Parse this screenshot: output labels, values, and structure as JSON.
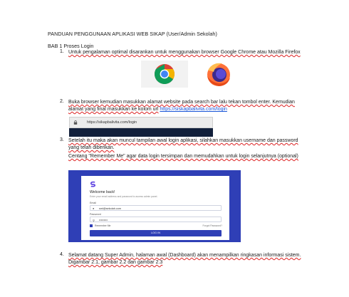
{
  "header": {
    "title": "PANDUAN PENGGUNAAN APLIKASI WEB SIKAP (User/Admin Sekolah)",
    "bab": "BAB 1 Proses Login"
  },
  "steps": [
    {
      "num": "1.",
      "text": "Untuk pengalaman optimal disarankan untuk menggunakan browser Google Chrome atau Mozilla Firefox"
    },
    {
      "num": "2.",
      "text": "Buka browser kemudian masukkan alamat website pada search bar lalu tekan tombol enter. Kemudian alamat yang final masukkan ke kolom url",
      "link": "https://siskapbalivita.com/login"
    },
    {
      "num": "3.",
      "text": "Setelah itu maka akan muncul tampilan awal login aplikasi, silahkan masukkan username dan password yang telah diberikan.",
      "extra": "Centang \"Remember Me\" agar data login tersimpan dan memudahkan untuk login selanjutnya (optional)"
    },
    {
      "num": "4.",
      "text": "Selamat datang Super Admin, halaman awal (Dashboard) akan menampilkan ringkasan informasi sistem. Digambar 2.1, gambar 2.2 dan gambar 2.3"
    }
  ],
  "url_image": {
    "url": "https://sikapbalivita.com/login"
  },
  "login_image": {
    "welcome": "Welcome back!",
    "subtitle": "Enter your email address and password to access admin panel.",
    "email_label": "Email",
    "email_value": "sml@sekolah.com",
    "password_label": "Password",
    "password_value": "•••••••••",
    "remember": "Remember Me",
    "forgot": "Forgot Password?",
    "button": "LOG IN"
  },
  "icons": [
    "chrome-logo-icon",
    "firefox-logo-icon",
    "lock-icon",
    "s-logo-icon",
    "user-icon",
    "key-icon"
  ]
}
